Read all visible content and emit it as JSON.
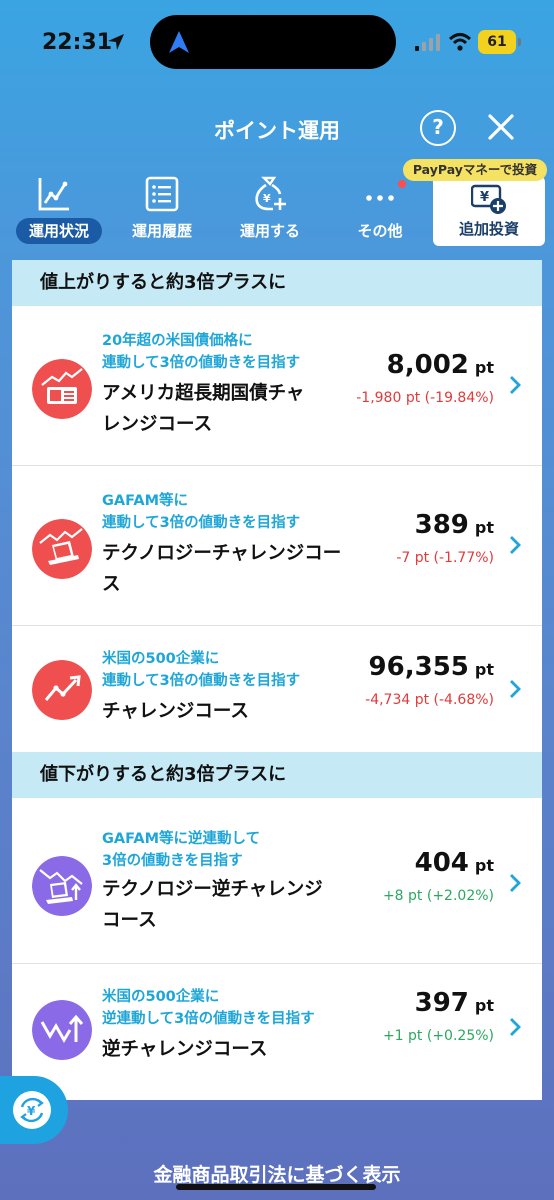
{
  "status_bar": {
    "time": "22:31",
    "battery": "61"
  },
  "header": {
    "title": "ポイント運用",
    "help": "?"
  },
  "tabs": [
    {
      "label": "運用状況",
      "active": true
    },
    {
      "label": "運用履歴"
    },
    {
      "label": "運用する"
    },
    {
      "label": "その他"
    }
  ],
  "add_invest": {
    "badge": "PayPayマネーで投資",
    "label": "追加投資"
  },
  "sections": [
    {
      "title": "値上がりすると約3倍プラスに"
    },
    {
      "title": "値下がりすると約3倍プラスに"
    }
  ],
  "courses": [
    {
      "sub1": "20年超の米国債価格に",
      "sub2": "連動して3倍の値動きを目指す",
      "name1": "アメリカ超長期国債チャ",
      "name2": "レンジコース",
      "points": "8,002",
      "unit": "pt",
      "change": "-1,980 pt (-19.84%)"
    },
    {
      "sub1": "GAFAM等に",
      "sub2": "連動して3倍の値動きを目指す",
      "name1": "テクノロジーチャレンジコー",
      "name2": "ス",
      "points": "389",
      "unit": "pt",
      "change": "-7 pt (-1.77%)"
    },
    {
      "sub1": "米国の500企業に",
      "sub2": "連動して3倍の値動きを目指す",
      "name1": "チャレンジコース",
      "points": "96,355",
      "unit": "pt",
      "change": "-4,734 pt (-4.68%)"
    },
    {
      "sub1": "GAFAM等に逆連動して",
      "sub2": "3倍の値動きを目指す",
      "name1": "テクノロジー逆チャレンジ",
      "name2": "コース",
      "points": "404",
      "unit": "pt",
      "change": "+8 pt (+2.02%)"
    },
    {
      "sub1": "米国の500企業に",
      "sub2": "逆連動して3倍の値動きを目指す",
      "name1": "逆チャレンジコース",
      "points": "397",
      "unit": "pt",
      "change": "+1 pt (+0.25%)"
    }
  ],
  "footer": {
    "text": "金融商品取引法に基づく表示"
  },
  "colors": {
    "accent": "#1fa6d8",
    "negative": "#e33a3a",
    "positive": "#2aa860",
    "up_icon": "#f04f4f",
    "down_icon": "#8a6ae6",
    "section_bg": "#c6e9f6"
  }
}
